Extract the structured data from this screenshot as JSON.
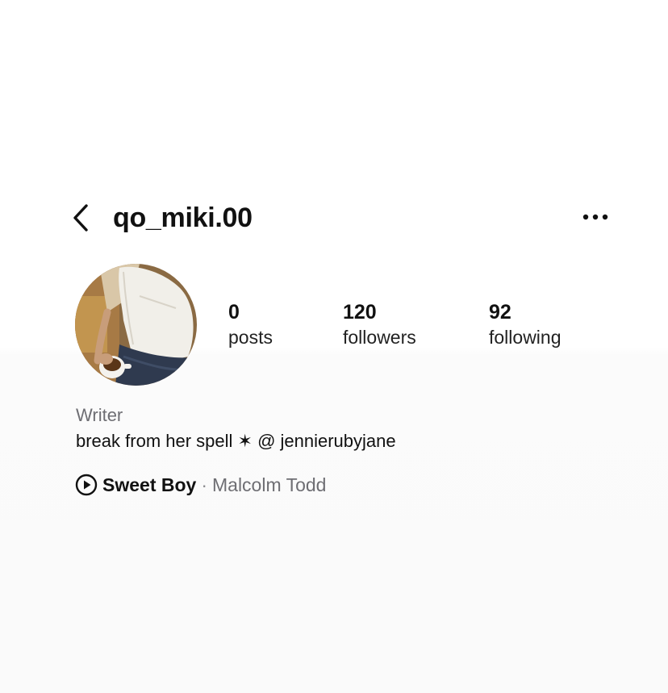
{
  "header": {
    "username": "qo_miki.00",
    "back_icon": "chevron-left-icon",
    "more_icon": "more-horizontal-icon"
  },
  "profile": {
    "avatar_description": "profile-photo",
    "stats": [
      {
        "value": "0",
        "label": "posts"
      },
      {
        "value": "120",
        "label": "followers"
      },
      {
        "value": "92",
        "label": "following"
      }
    ]
  },
  "bio": {
    "category": "Writer",
    "text": "break from her spell ✶ @ jennierubyjane"
  },
  "music": {
    "icon": "play-circle-icon",
    "title": "Sweet Boy",
    "separator": "·",
    "artist": "Malcolm Todd"
  },
  "colors": {
    "text_primary": "#111111",
    "text_secondary": "#6e6e73",
    "background": "#ffffff"
  }
}
